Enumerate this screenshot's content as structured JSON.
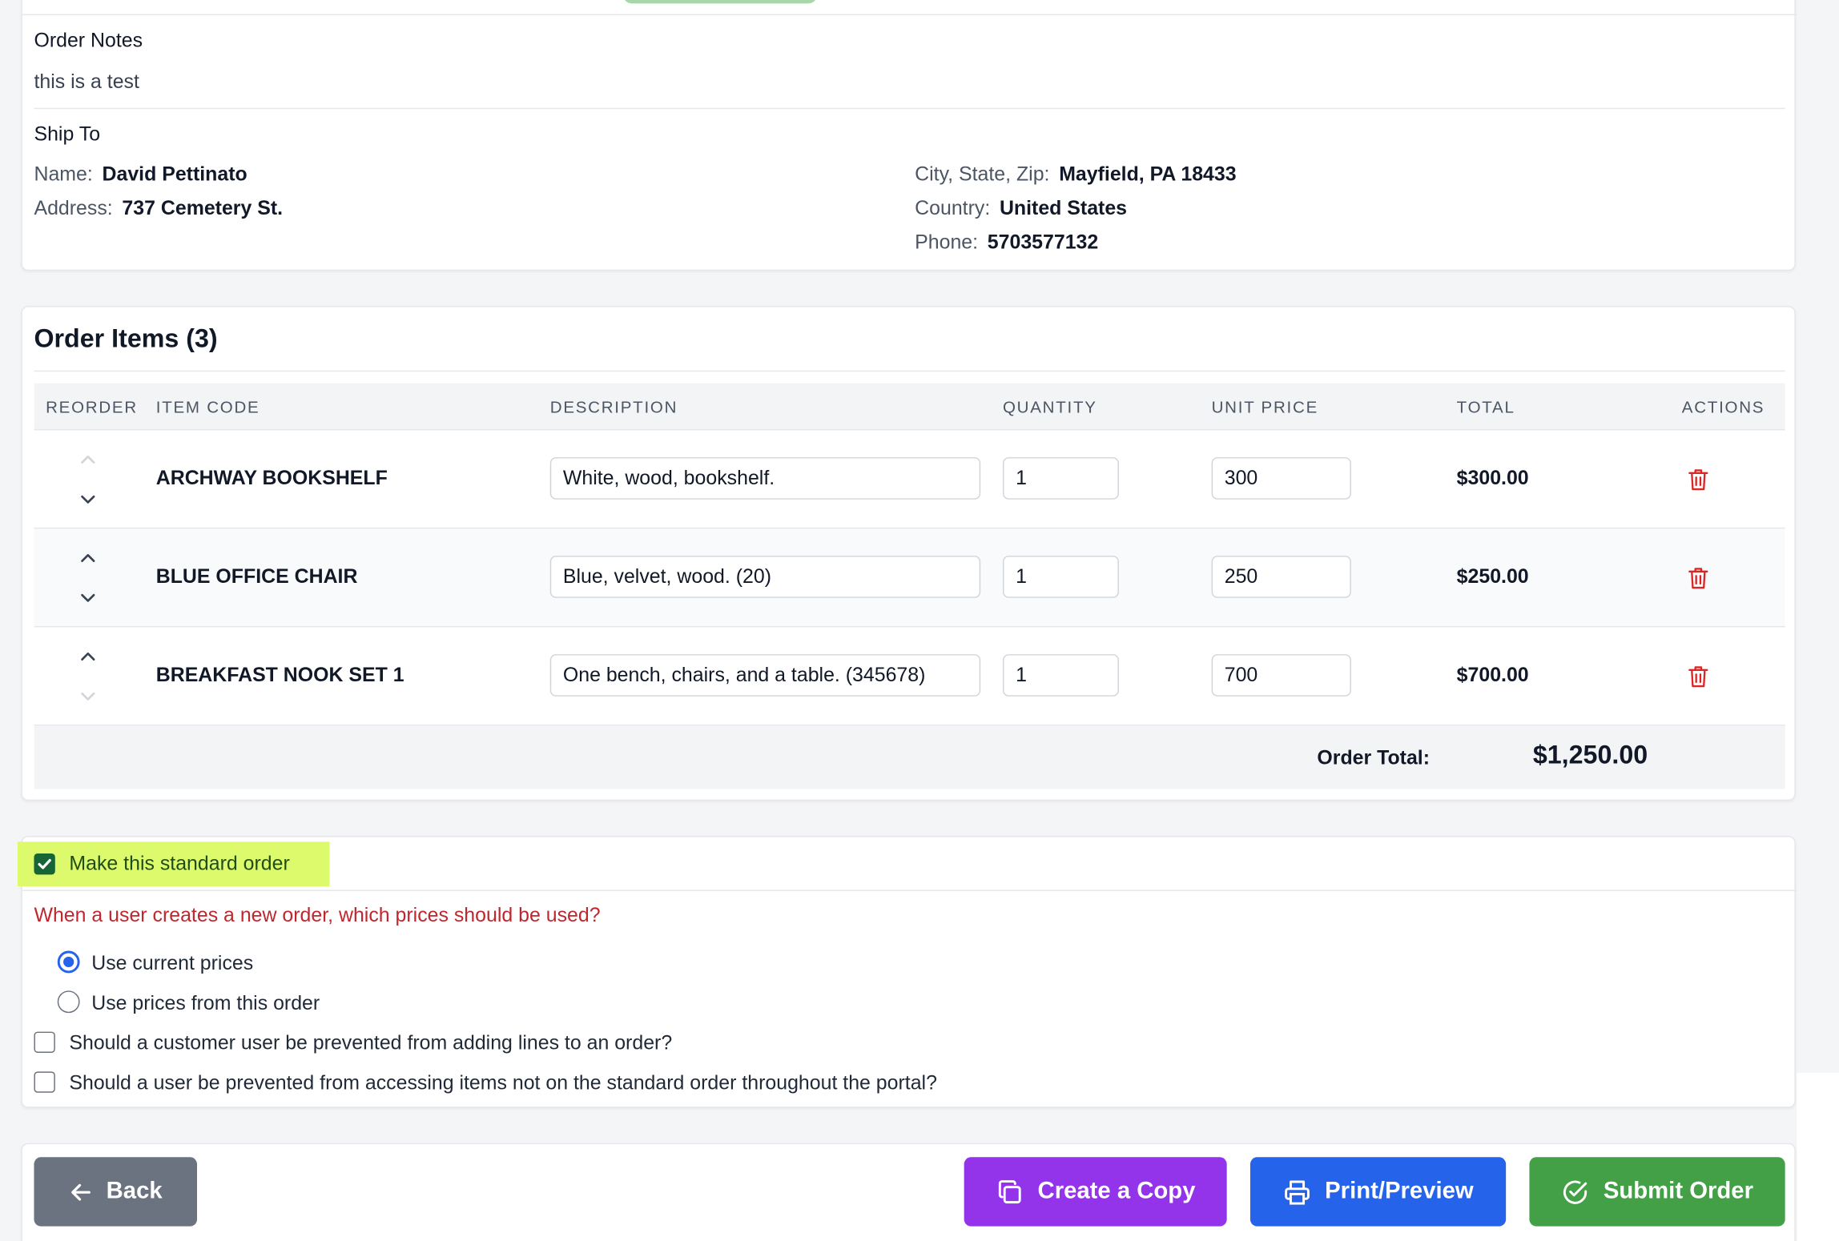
{
  "notes": {
    "title": "Order Notes",
    "text": "this is a test"
  },
  "ship_to": {
    "title": "Ship To",
    "name_label": "Name:",
    "name": "David Pettinato",
    "address_label": "Address:",
    "address": "737 Cemetery St.",
    "city_label": "City, State, Zip:",
    "city": "Mayfield, PA 18433",
    "country_label": "Country:",
    "country": "United States",
    "phone_label": "Phone:",
    "phone": "5703577132"
  },
  "items": {
    "title": "Order Items (3)",
    "columns": [
      "REORDER",
      "ITEM CODE",
      "DESCRIPTION",
      "QUANTITY",
      "UNIT PRICE",
      "TOTAL",
      "ACTIONS"
    ],
    "rows": [
      {
        "code": "ARCHWAY BOOKSHELF",
        "description": "White, wood, bookshelf.",
        "quantity": "1",
        "unit_price": "300",
        "total": "$300.00",
        "up_enabled": false,
        "down_enabled": true
      },
      {
        "code": "BLUE OFFICE CHAIR",
        "description": "Blue, velvet, wood. (20)",
        "quantity": "1",
        "unit_price": "250",
        "total": "$250.00",
        "up_enabled": true,
        "down_enabled": true
      },
      {
        "code": "BREAKFAST NOOK SET 1",
        "description": "One bench, chairs, and a table. (345678)",
        "quantity": "1",
        "unit_price": "700",
        "total": "$700.00",
        "up_enabled": true,
        "down_enabled": false
      }
    ],
    "order_total_label": "Order Total:",
    "order_total": "$1,250.00"
  },
  "standard_order": {
    "make_standard_label": "Make this standard order",
    "make_standard_checked": true,
    "question": "When a user creates a new order, which prices should be used?",
    "price_options": [
      "Use current prices",
      "Use prices from this order"
    ],
    "selected_price_option": "Use current prices",
    "prevent_add_lines_label": "Should a customer user be prevented from adding lines to an order?",
    "prevent_add_lines_checked": false,
    "prevent_access_label": "Should a user be prevented from accessing items not on the standard order throughout the portal?",
    "prevent_access_checked": false
  },
  "footer": {
    "back": "Back",
    "copy": "Create a Copy",
    "print": "Print/Preview",
    "submit": "Submit Order"
  },
  "colors": {
    "highlight": "#dcfa6b",
    "question_red": "#c0262d",
    "trash_red": "#dc2626",
    "back_gray": "#6b7280",
    "copy_purple": "#9333ea",
    "print_blue": "#2563eb",
    "submit_green": "#43a047"
  }
}
